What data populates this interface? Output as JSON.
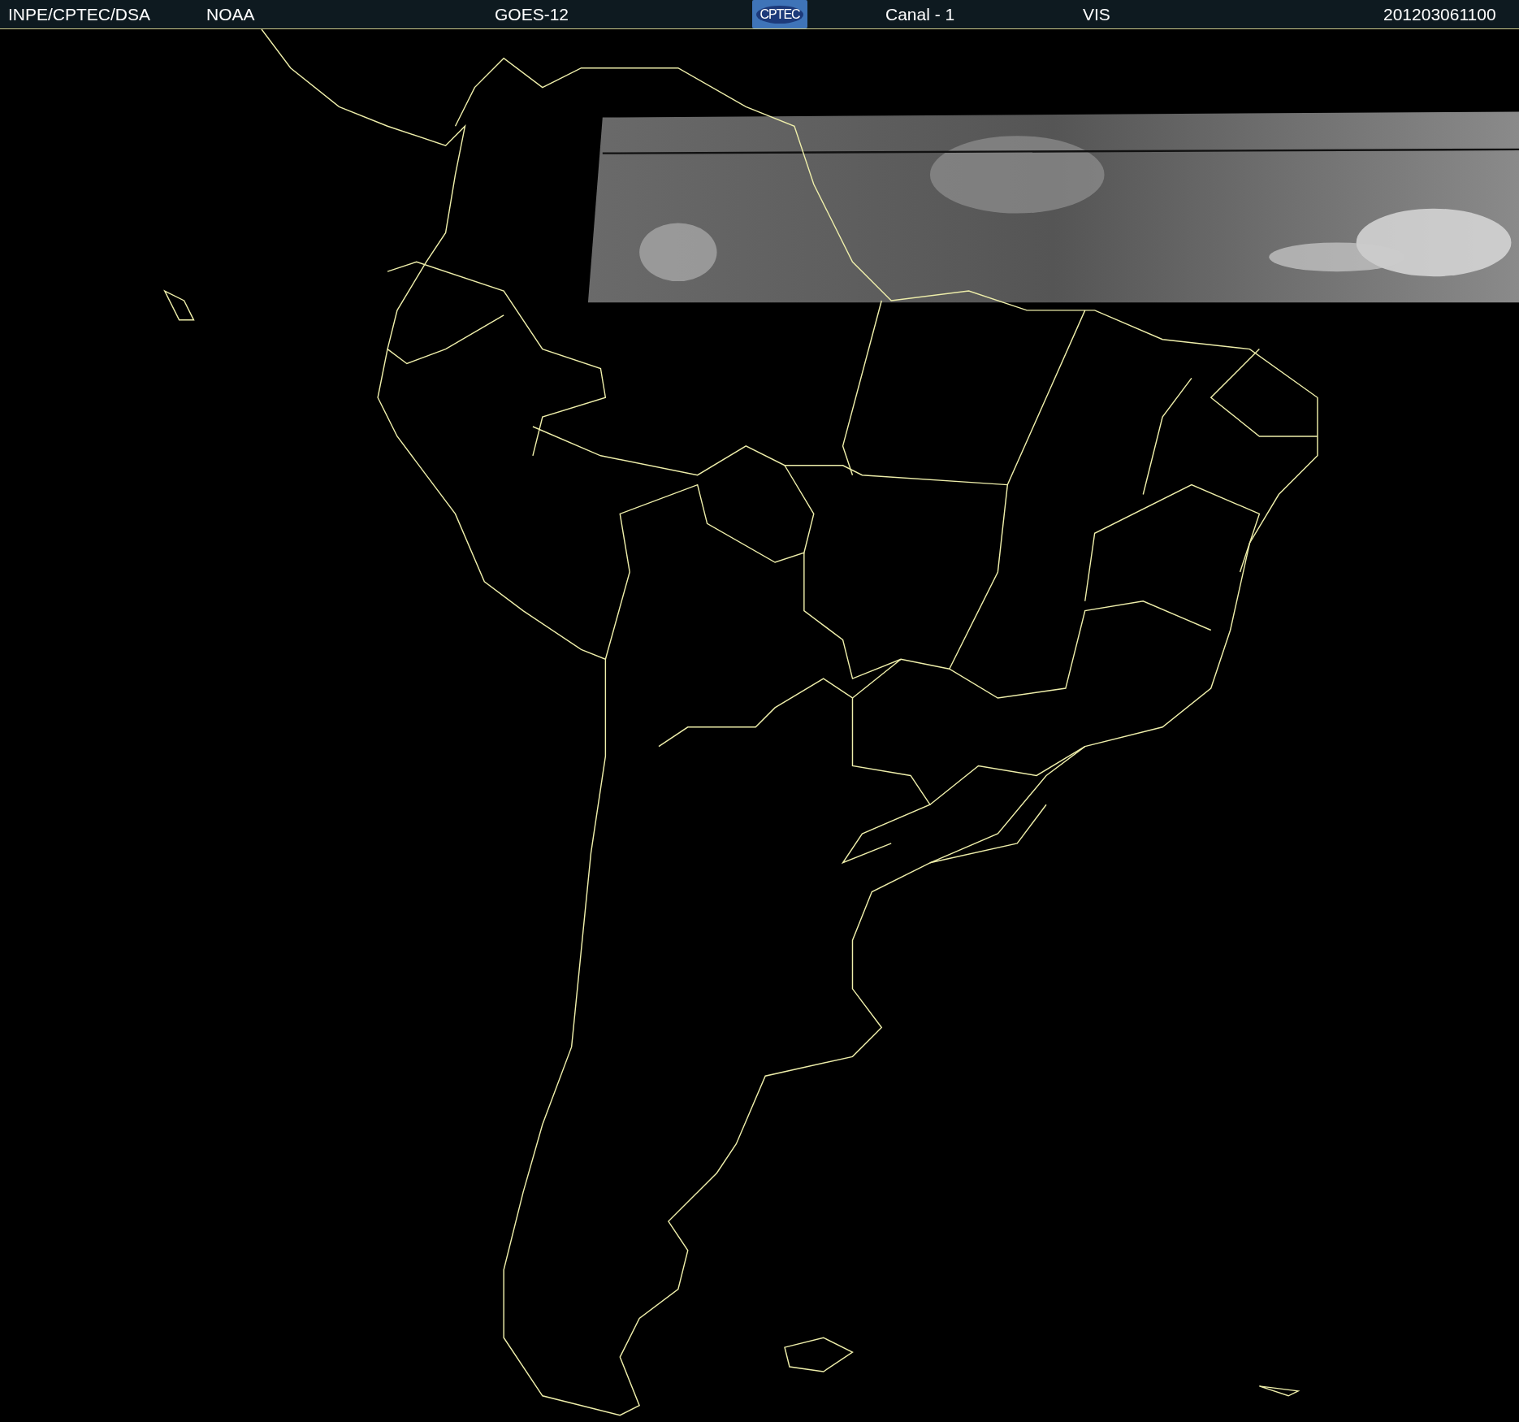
{
  "header": {
    "items": [
      {
        "kind": "label",
        "text": "INPE/CPTEC/DSA"
      },
      {
        "kind": "label",
        "text": "NOAA"
      },
      {
        "kind": "label",
        "text": "GOES-12"
      },
      {
        "kind": "logo",
        "text": "CPTEC"
      },
      {
        "kind": "label",
        "text": "Canal - 1"
      },
      {
        "kind": "label",
        "text": "VIS"
      },
      {
        "kind": "label",
        "text": "201203061100"
      }
    ]
  }
}
